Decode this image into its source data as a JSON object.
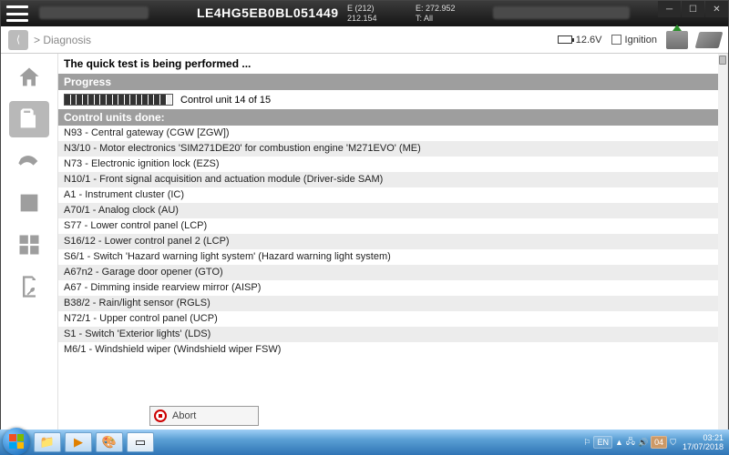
{
  "titlebar": {
    "vin": "LE4HG5EB0BL051449",
    "group1_line1": "E (212)",
    "group1_line2": "212.154",
    "group2_line1": "E: 272.952",
    "group2_line2": "T: All"
  },
  "subbar": {
    "breadcrumb": "> Diagnosis",
    "voltage": "12.6V",
    "ignition_label": "Ignition"
  },
  "rail": {
    "home": "home-icon",
    "diagnosis": "clipboard-engine-icon",
    "help": "whistle-icon",
    "list": "list-icon",
    "grid": "grid-icon",
    "doc": "doc-wrench-icon"
  },
  "main": {
    "status_title": "The quick test is being performed ...",
    "progress_header": "Progress",
    "progress_label": "Control unit 14 of 15",
    "progress_current": 14,
    "progress_total": 15,
    "done_header": "Control units done:",
    "units": [
      "N93 - Central gateway (CGW [ZGW])",
      "N3/10 - Motor electronics 'SIM271DE20' for combustion engine 'M271EVO' (ME)",
      "N73 - Electronic ignition lock (EZS)",
      "N10/1 - Front signal acquisition and actuation module (Driver-side SAM)",
      "A1 - Instrument cluster (IC)",
      "A70/1 - Analog clock (AU)",
      "S77 - Lower control panel (LCP)",
      "S16/12 - Lower control panel 2 (LCP)",
      "S6/1 - Switch 'Hazard warning light system' (Hazard warning light system)",
      "A67n2 - Garage door opener (GTO)",
      "A67 - Dimming inside rearview mirror (AISP)",
      "B38/2 - Rain/light sensor (RGLS)",
      "N72/1 - Upper control panel (UCP)",
      "S1 - Switch 'Exterior lights' (LDS)",
      "M6/1 - Windshield wiper (Windshield wiper FSW)"
    ],
    "abort_label": "Abort"
  },
  "taskbar": {
    "lang": "EN",
    "badge": "04",
    "time": "03:21",
    "date": "17/07/2018"
  }
}
